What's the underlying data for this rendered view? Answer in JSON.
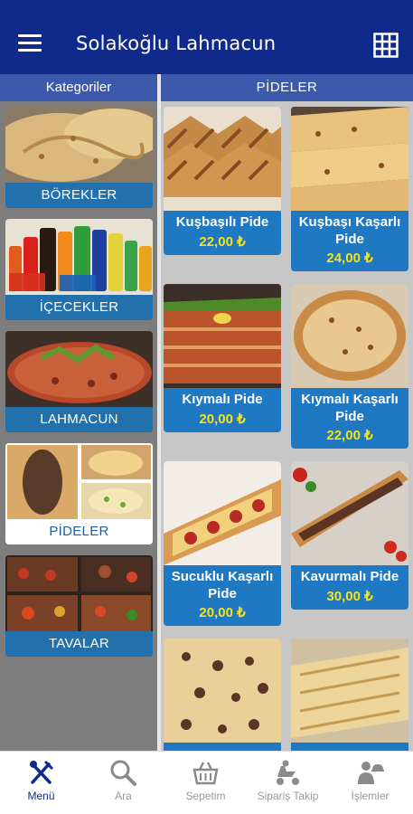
{
  "appbar": {
    "title": "Solakoğlu Lahmacun"
  },
  "categories": {
    "header": "Kategoriler",
    "items": [
      {
        "label": "BÖREKLER",
        "image": "borek-photo"
      },
      {
        "label": "İÇECEKLER",
        "image": "drinks-photo"
      },
      {
        "label": "LAHMACUN",
        "image": "lahmacun-photo"
      },
      {
        "label": "PİDELER",
        "image": "pide-photo",
        "active": true
      },
      {
        "label": "TAVALAR",
        "image": "tava-photo"
      }
    ]
  },
  "products": {
    "header": "PİDELER",
    "items": [
      {
        "name": "Kuşbaşılı Pide",
        "price": "22,00 ₺"
      },
      {
        "name": "Kuşbaşı Kaşarlı Pide",
        "price": "24,00 ₺"
      },
      {
        "name": "Kıymalı Pide",
        "price": "20,00 ₺"
      },
      {
        "name": "Kıymalı Kaşarlı Pide",
        "price": "22,00 ₺"
      },
      {
        "name": "Sucuklu Kaşarlı Pide",
        "price": "20,00 ₺"
      },
      {
        "name": "Kavurmalı Pide",
        "price": "30,00 ₺"
      },
      {
        "name": "",
        "price": ""
      },
      {
        "name": "",
        "price": ""
      }
    ]
  },
  "bottom_nav": {
    "items": [
      {
        "label": "Menü",
        "icon": "fork-knife-icon",
        "active": true
      },
      {
        "label": "Ara",
        "icon": "search-icon"
      },
      {
        "label": "Sepetim",
        "icon": "basket-icon"
      },
      {
        "label": "Sipariş Takip",
        "icon": "delivery-icon"
      },
      {
        "label": "İşlemler",
        "icon": "waiter-icon"
      }
    ]
  },
  "colors": {
    "primary": "#102a8c",
    "header": "#3d59ab",
    "card": "#1e78c2",
    "price": "#f7e11a"
  }
}
